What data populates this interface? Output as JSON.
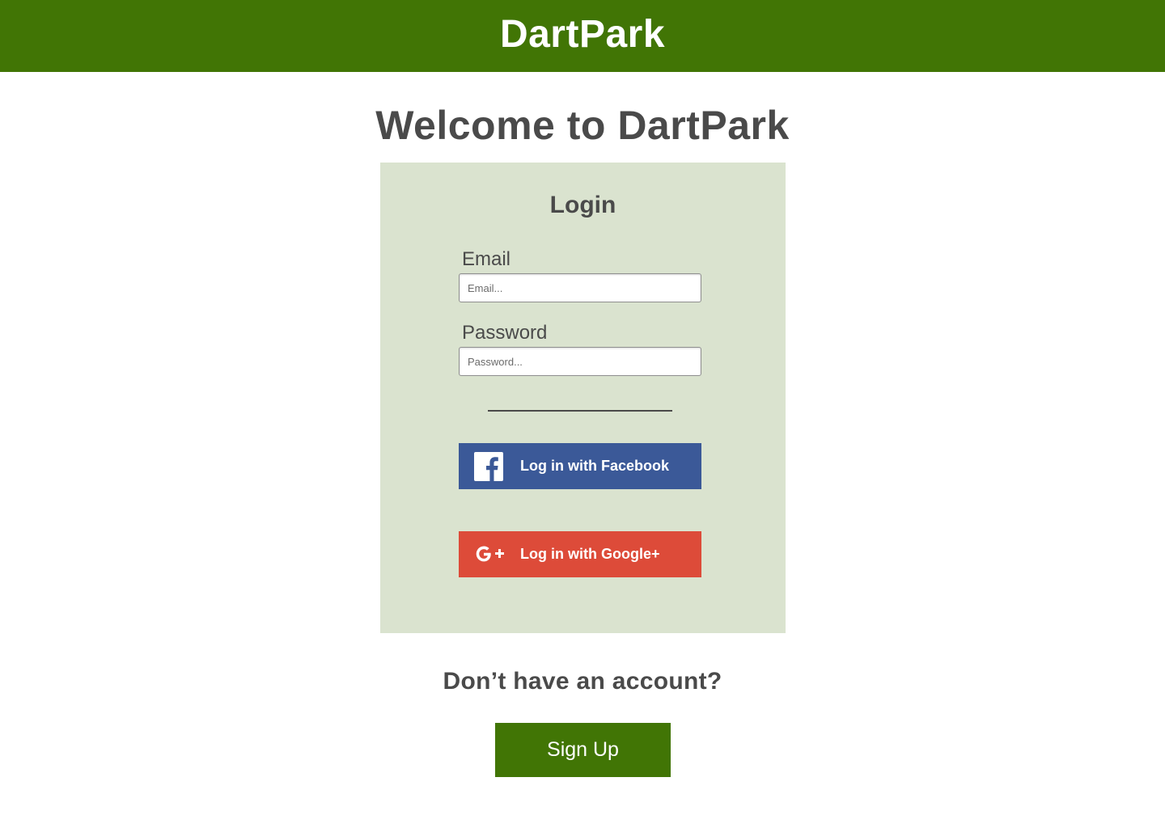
{
  "header": {
    "brand": "DartPark",
    "bg_color": "#417505"
  },
  "main": {
    "welcome": "Welcome to DartPark"
  },
  "login": {
    "title": "Login",
    "card_color": "#dae3cf",
    "email": {
      "label": "Email",
      "placeholder": "Email...",
      "value": ""
    },
    "password": {
      "label": "Password",
      "placeholder": "Password...",
      "value": ""
    },
    "facebook": {
      "label": "Log in with Facebook",
      "icon": "facebook-icon",
      "color": "#3b5998"
    },
    "google": {
      "label": "Log in with Google+",
      "icon": "google-plus-icon",
      "color": "#dd4b39"
    }
  },
  "signup": {
    "prompt": "Don’t have an account?",
    "button_label": "Sign Up",
    "color": "#417505"
  }
}
